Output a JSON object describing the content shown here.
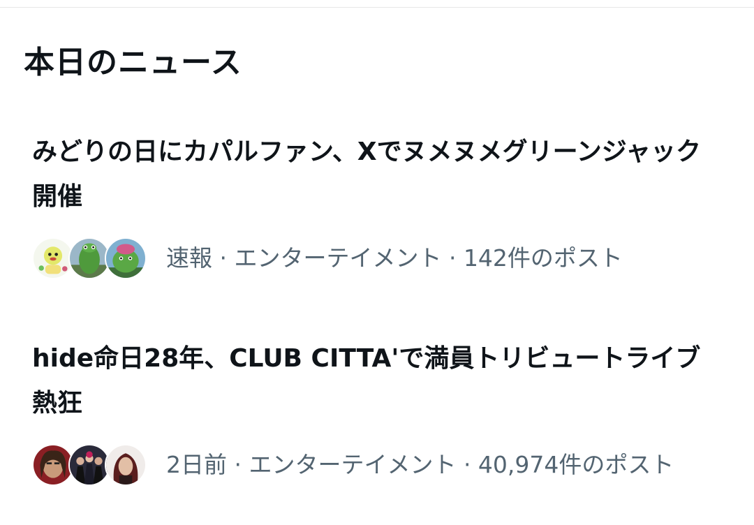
{
  "section": {
    "title": "本日のニュース"
  },
  "news": [
    {
      "headline": "みどりの日にカパルファン、Xでヌメヌメグリーンジャック開催",
      "meta": "速報 · エンターテイメント · 142件のポスト",
      "avatars": [
        "kaparu-mascot-avatar",
        "green-frog-costume-avatar",
        "kaparu-costume-avatar"
      ]
    },
    {
      "headline": "hide命日28年、CLUB CITTA'で満員トリビュートライブ熱狂",
      "meta": "2日前 · エンターテイメント · 40,974件のポスト",
      "avatars": [
        "woman-portrait-avatar",
        "band-group-avatar",
        "red-hair-woman-avatar"
      ]
    }
  ],
  "colors": {
    "text_primary": "#0f1419",
    "text_secondary": "#536471",
    "background": "#ffffff"
  }
}
